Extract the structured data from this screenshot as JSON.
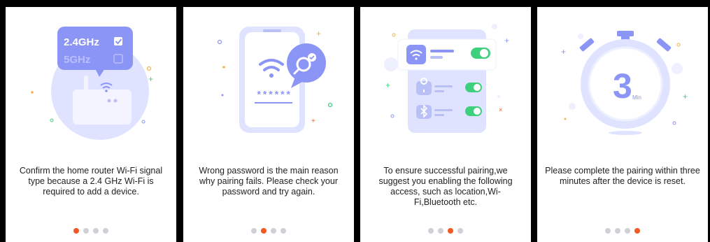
{
  "cards": [
    {
      "caption": "Confirm the home router Wi-Fi signal type because a 2.4 GHz Wi-Fi is required to add a device.",
      "band_primary": "2.4GHz",
      "band_secondary": "5GHz",
      "active_dot": 0
    },
    {
      "caption": "Wrong password is the main reason why pairing fails. Please check your password and try again.",
      "password_mask": "******",
      "active_dot": 1
    },
    {
      "caption": "To ensure successful pairing,we suggest you enabling the following access, such as location,Wi-Fi,Bluetooth etc.",
      "active_dot": 2
    },
    {
      "caption": "Please complete the pairing within three minutes after the device is reset.",
      "timer_value": "3",
      "timer_unit": "Min",
      "active_dot": 3
    }
  ],
  "colors": {
    "accent": "#f15a24",
    "illustration": "#8b95f5",
    "illustration_light": "#dfe3ff",
    "toggle": "#3fd07e"
  }
}
